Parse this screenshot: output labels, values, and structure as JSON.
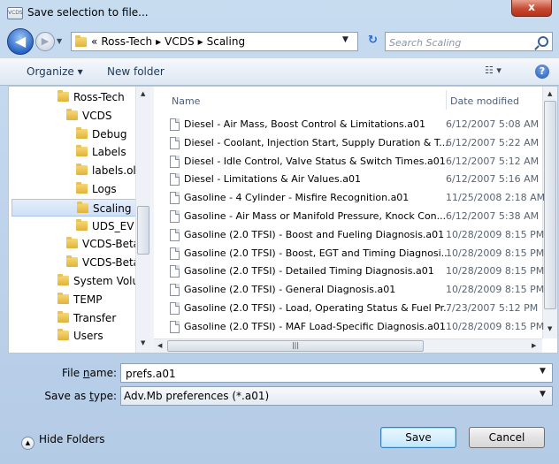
{
  "window": {
    "title": "Save selection to file...",
    "close_label": "x"
  },
  "nav": {
    "back_label": "◀",
    "forward_label": "▶",
    "breadcrumb": [
      "«",
      "Ross-Tech",
      "▸",
      "VCDS",
      "▸",
      "Scaling"
    ],
    "search_placeholder": "Search Scaling"
  },
  "toolbar": {
    "organize_label": "Organize ▾",
    "new_folder_label": "New folder",
    "views_label": "☷ ▾",
    "help_label": "?"
  },
  "nav_tree": [
    {
      "label": "Ross-Tech",
      "indent": 2
    },
    {
      "label": "VCDS",
      "indent": 3
    },
    {
      "label": "Debug",
      "indent": 4
    },
    {
      "label": "Labels",
      "indent": 4
    },
    {
      "label": "labels.old",
      "indent": 4
    },
    {
      "label": "Logs",
      "indent": 4
    },
    {
      "label": "Scaling",
      "indent": 4,
      "selected": true
    },
    {
      "label": "UDS_EV",
      "indent": 4
    },
    {
      "label": "VCDS-Beta",
      "indent": 3
    },
    {
      "label": "VCDS-Beta",
      "indent": 3
    },
    {
      "label": "System Volur",
      "indent": 2
    },
    {
      "label": "TEMP",
      "indent": 2
    },
    {
      "label": "Transfer",
      "indent": 2
    },
    {
      "label": "Users",
      "indent": 2
    }
  ],
  "columns": {
    "name": "Name",
    "date": "Date modified"
  },
  "files": [
    {
      "name": "Diesel - Air Mass, Boost Control & Limitations.a01",
      "date": "6/12/2007 5:08 AM"
    },
    {
      "name": "Diesel - Coolant, Injection Start, Supply Duration & T...",
      "date": "6/12/2007 5:22 AM"
    },
    {
      "name": "Diesel - Idle Control, Valve Status & Switch Times.a01",
      "date": "6/12/2007 5:12 AM"
    },
    {
      "name": "Diesel - Limitations & Air Values.a01",
      "date": "6/12/2007 5:16 AM"
    },
    {
      "name": "Gasoline - 4 Cylinder - Misfire Recognition.a01",
      "date": "11/25/2008 2:18 AM"
    },
    {
      "name": "Gasoline - Air Mass or Manifold Pressure, Knock Con...",
      "date": "6/12/2007 5:38 AM"
    },
    {
      "name": "Gasoline (2.0 TFSI) - Boost and Fueling Diagnosis.a01",
      "date": "10/28/2009 8:15 PM"
    },
    {
      "name": "Gasoline (2.0 TFSI) - Boost, EGT and Timing Diagnosi...",
      "date": "10/28/2009 8:15 PM"
    },
    {
      "name": "Gasoline (2.0 TFSI) - Detailed Timing Diagnosis.a01",
      "date": "10/28/2009 8:15 PM"
    },
    {
      "name": "Gasoline (2.0 TFSI) - General Diagnosis.a01",
      "date": "10/28/2009 8:15 PM"
    },
    {
      "name": "Gasoline (2.0 TFSI) - Load, Operating Status & Fuel Pr...",
      "date": "7/23/2007 5:12 PM"
    },
    {
      "name": "Gasoline (2.0 TFSI) - MAF Load-Specific Diagnosis.a01",
      "date": "10/28/2009 8:15 PM"
    }
  ],
  "form": {
    "file_name_label_pre": "File ",
    "file_name_label_u": "n",
    "file_name_label_post": "ame:",
    "file_name_value": "prefs.a01",
    "save_type_label_pre": "Save as ",
    "save_type_label_u": "t",
    "save_type_label_post": "ype:",
    "save_type_value": "Adv.Mb preferences (*.a01)"
  },
  "footer": {
    "hide_folders_label": "Hide Folders",
    "save_label": "Save",
    "cancel_label": "Cancel"
  },
  "scrollbar_glyph": "|||"
}
